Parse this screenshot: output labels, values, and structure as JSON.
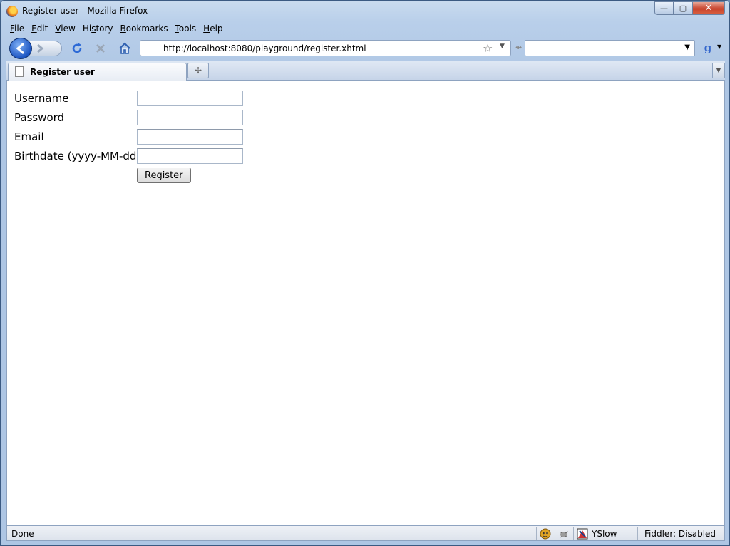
{
  "window": {
    "title": "Register user - Mozilla Firefox",
    "minimize": "—",
    "maximize": "▢",
    "close": "✕"
  },
  "menu": [
    {
      "key": "F",
      "rest": "ile"
    },
    {
      "key": "E",
      "rest": "dit"
    },
    {
      "key": "V",
      "rest": "iew"
    },
    {
      "key": "",
      "rest": "Hi",
      "key2": "s",
      "rest2": "tory"
    },
    {
      "key": "B",
      "rest": "ookmarks"
    },
    {
      "key": "T",
      "rest": "ools"
    },
    {
      "key": "H",
      "rest": "elp"
    }
  ],
  "navbar": {
    "url": "http://localhost:8080/playground/register.xhtml",
    "search_value": ""
  },
  "tabs": [
    {
      "label": "Register user"
    }
  ],
  "form": {
    "username_label": "Username",
    "password_label": "Password",
    "email_label": "Email",
    "birthdate_label": "Birthdate (yyyy-MM-dd)",
    "username_value": "",
    "password_value": "",
    "email_value": "",
    "birthdate_value": "",
    "submit_label": "Register"
  },
  "status": {
    "text": "Done",
    "yslow": "YSlow",
    "fiddler": "Fiddler: Disabled"
  },
  "icons": {
    "back": "back-arrow-icon",
    "forward": "forward-arrow-icon",
    "reload": "reload-icon",
    "stop": "stop-icon",
    "home": "home-icon",
    "bookmark_star": "star-icon",
    "search_engine": "google-icon"
  }
}
